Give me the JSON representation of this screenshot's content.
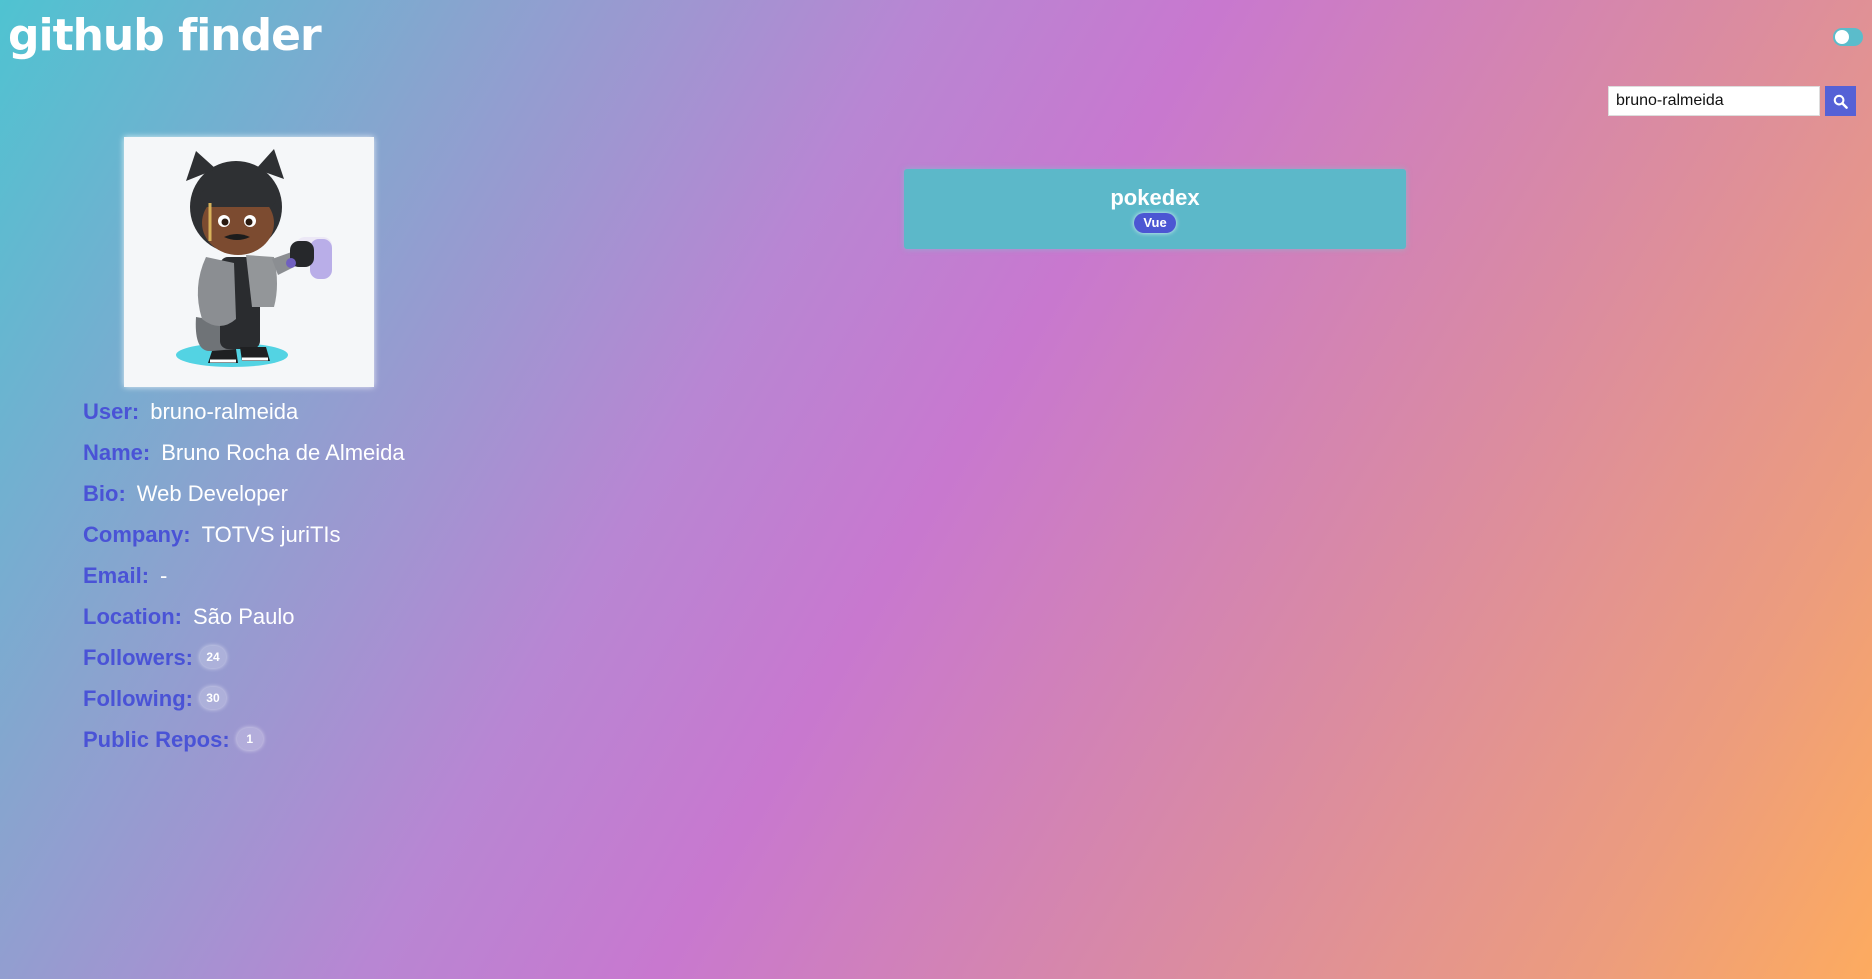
{
  "app": {
    "title": "github finder"
  },
  "search": {
    "value": "bruno-ralmeida",
    "button_icon": "search-icon"
  },
  "theme_toggle": {
    "state": "off"
  },
  "profile": {
    "avatar_icon": "user-avatar",
    "fields": [
      {
        "label": "User:",
        "value": "bruno-ralmeida"
      },
      {
        "label": "Name:",
        "value": "Bruno Rocha de Almeida"
      },
      {
        "label": "Bio:",
        "value": "Web Developer"
      },
      {
        "label": "Company:",
        "value": "TOTVS juriTIs"
      },
      {
        "label": "Email:",
        "value": "-"
      },
      {
        "label": "Location:",
        "value": "São Paulo"
      }
    ],
    "stats": [
      {
        "label": "Followers:",
        "value": "24"
      },
      {
        "label": "Following:",
        "value": "30"
      },
      {
        "label": "Public Repos:",
        "value": "1"
      }
    ]
  },
  "repos": [
    {
      "name": "pokedex",
      "language": "Vue"
    }
  ],
  "colors": {
    "label": "#4a53d6",
    "repo_card": "#5cb8c9",
    "search_button": "#5561d6",
    "language_badge": "#4c56d3"
  }
}
